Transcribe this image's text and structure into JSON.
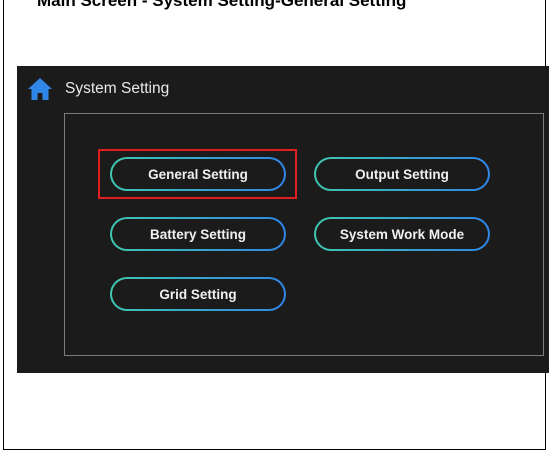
{
  "document": {
    "title": "Main Screen - System Setting-General Setting"
  },
  "header": {
    "title": "System Setting",
    "icon": "home-icon"
  },
  "buttons": {
    "general": "General Setting",
    "output": "Output Setting",
    "battery": "Battery Setting",
    "work_mode": "System Work Mode",
    "grid": "Grid Setting"
  },
  "colors": {
    "screen_bg": "#1b1b1b",
    "accent_teal": "#3fc6b0",
    "accent_blue": "#2f86e6",
    "highlight": "#e02020",
    "home_icon": "#2f86e6"
  },
  "selected": "general"
}
